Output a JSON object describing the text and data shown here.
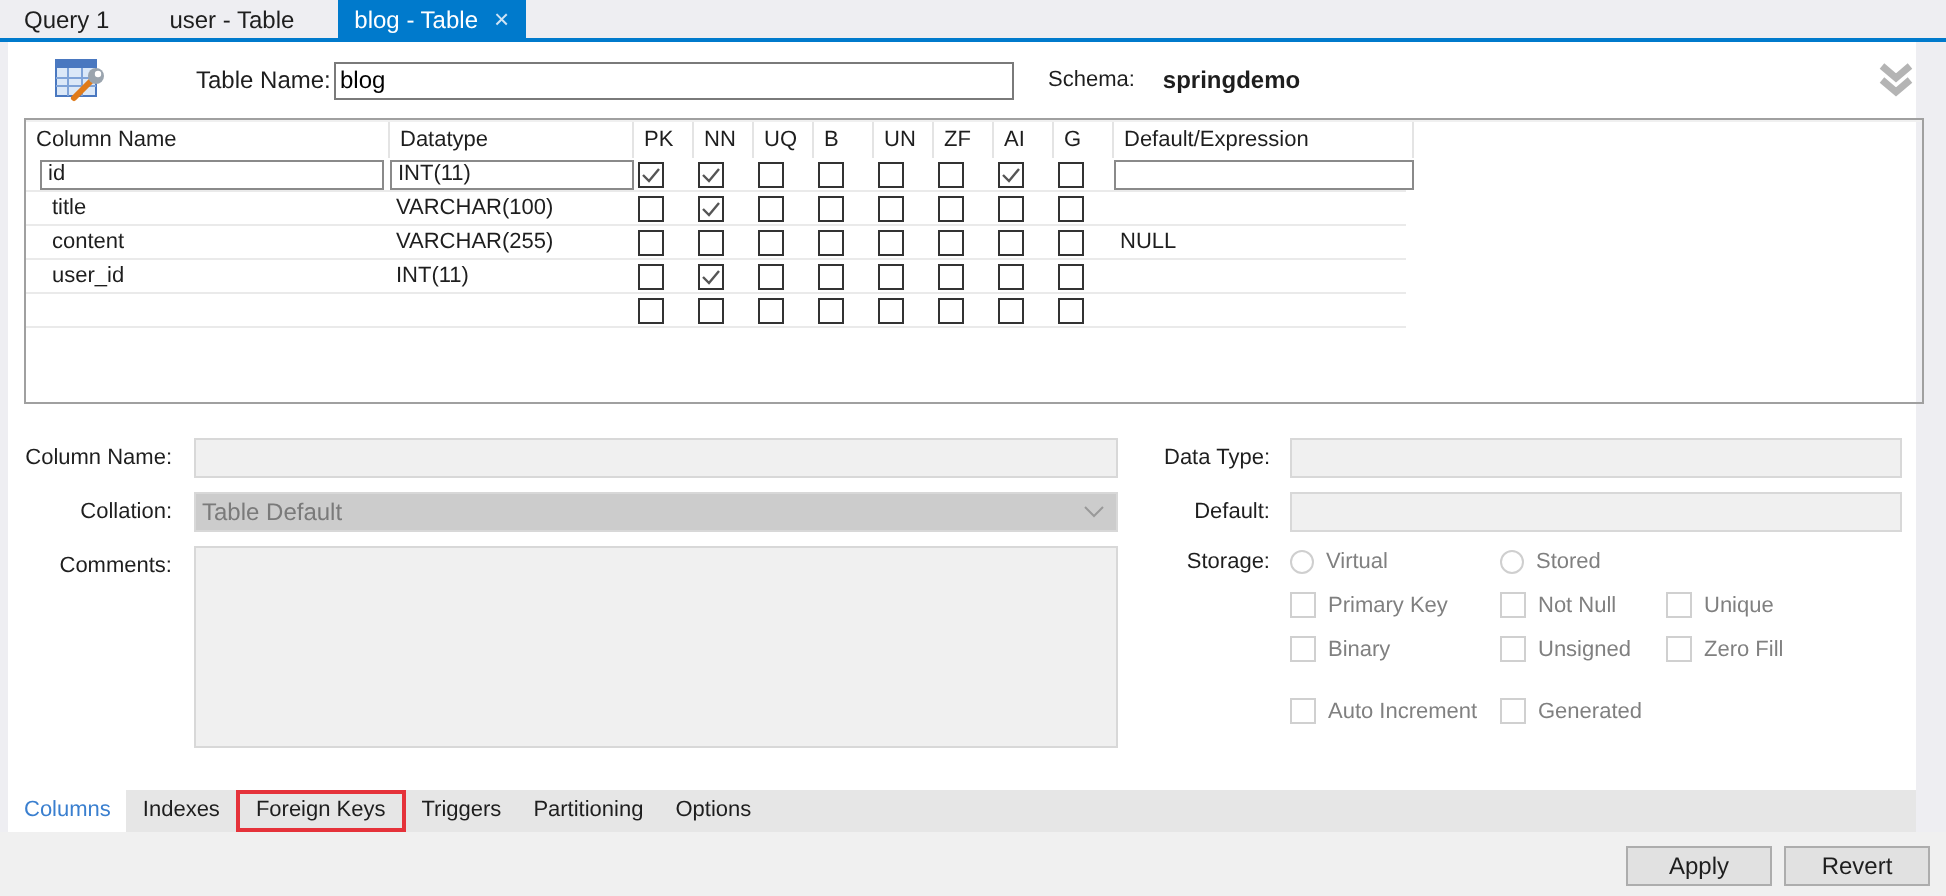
{
  "tabs": [
    {
      "label": "Query 1",
      "selected": false,
      "closable": false
    },
    {
      "label": "user - Table",
      "selected": false,
      "closable": false
    },
    {
      "label": "blog - Table",
      "selected": true,
      "closable": true,
      "close": "×"
    }
  ],
  "header": {
    "table_name_label": "Table Name:",
    "table_name": "blog",
    "schema_label": "Schema:",
    "schema": "springdemo"
  },
  "grid": {
    "columns": [
      "Column Name",
      "Datatype",
      "PK",
      "NN",
      "UQ",
      "B",
      "UN",
      "ZF",
      "AI",
      "G",
      "Default/Expression"
    ],
    "rows": [
      {
        "name": "id",
        "datatype": "INT(11)",
        "flags": [
          true,
          true,
          false,
          false,
          false,
          false,
          true,
          false
        ],
        "editing": true
      },
      {
        "name": "title",
        "datatype": "VARCHAR(100)",
        "flags": [
          false,
          true,
          false,
          false,
          false,
          false,
          false,
          false
        ],
        "editing": false
      },
      {
        "name": "content",
        "datatype": "VARCHAR(255)",
        "flags": [
          false,
          false,
          false,
          false,
          false,
          false,
          false,
          false
        ],
        "default": "NULL",
        "editing": false
      },
      {
        "name": "user_id",
        "datatype": "INT(11)",
        "flags": [
          false,
          true,
          false,
          false,
          false,
          false,
          false,
          false
        ],
        "editing": false
      },
      {
        "flags": [
          false,
          false,
          false,
          false,
          false,
          false,
          false,
          false
        ],
        "editing": false
      }
    ]
  },
  "details": {
    "left": [
      {
        "label": "Column Name:",
        "kind": "text"
      },
      {
        "label": "Collation:",
        "kind": "select",
        "value": "Table Default"
      },
      {
        "label": "Comments:",
        "kind": "textarea"
      }
    ],
    "right": [
      {
        "label": "Data Type:",
        "kind": "text"
      },
      {
        "label": "Default:",
        "kind": "text"
      }
    ],
    "storage_label": "Storage:",
    "radios": [
      {
        "label": "Virtual",
        "selected": false
      },
      {
        "label": "Stored",
        "selected": false
      }
    ],
    "checkboxes": [
      {
        "label": "Primary Key",
        "checked": false
      },
      {
        "label": "Not Null",
        "checked": false
      },
      {
        "label": "Unique",
        "checked": false
      },
      {
        "label": "Binary",
        "checked": false
      },
      {
        "label": "Unsigned",
        "checked": false
      },
      {
        "label": "Zero Fill",
        "checked": false
      },
      {
        "label": "Auto Increment",
        "checked": false
      },
      {
        "label": "Generated",
        "checked": false
      }
    ]
  },
  "bottom_tabs": [
    {
      "label": "Columns",
      "selected": true,
      "highlighted": false
    },
    {
      "label": "Indexes",
      "selected": false,
      "highlighted": false
    },
    {
      "label": "Foreign Keys",
      "selected": false,
      "highlighted": true
    },
    {
      "label": "Triggers",
      "selected": false,
      "highlighted": false
    },
    {
      "label": "Partitioning",
      "selected": false,
      "highlighted": false
    },
    {
      "label": "Options",
      "selected": false,
      "highlighted": false
    }
  ],
  "buttons": [
    "Apply",
    "Revert"
  ]
}
